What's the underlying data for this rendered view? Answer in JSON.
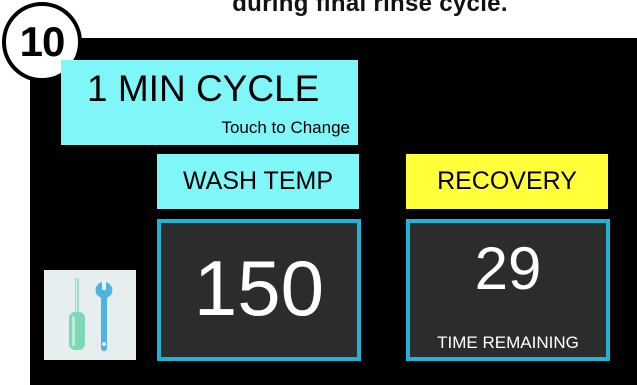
{
  "caption": "during final rinse cycle.",
  "step_number": "10",
  "cycle": {
    "title": "1 MIN CYCLE",
    "subtitle": "Touch to Change"
  },
  "wash": {
    "label": "WASH TEMP",
    "value": "150"
  },
  "recovery": {
    "label": "RECOVERY",
    "value": "29",
    "caption": "TIME REMAINING"
  },
  "tools_icon": "screwdriver-wrench-icon",
  "colors": {
    "background": "#000000",
    "cyan_button": "#7ff7f9",
    "yellow_label": "#ffff3a",
    "value_border": "#1fb4d6",
    "value_panel": "#2c2c2c"
  }
}
